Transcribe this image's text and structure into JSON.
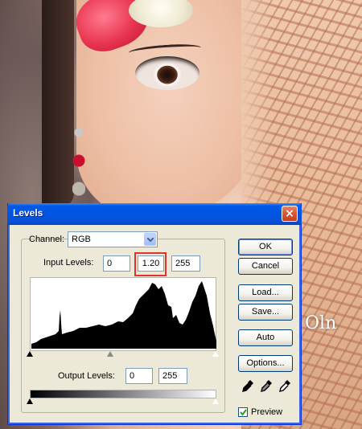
{
  "dialog": {
    "title": "Levels",
    "close_glyph": "×",
    "channel": {
      "label": "Channel:",
      "value": "RGB"
    },
    "input_levels": {
      "label": "Input Levels:",
      "black": "0",
      "gamma": "1.20",
      "white": "255"
    },
    "output_levels": {
      "label": "Output Levels:",
      "black": "0",
      "white": "255"
    },
    "buttons": {
      "ok": "OK",
      "cancel": "Cancel",
      "load": "Load...",
      "save": "Save...",
      "auto": "Auto",
      "options": "Options..."
    },
    "preview": {
      "label": "Preview",
      "checked": true
    },
    "eyedroppers": [
      "black-point-eyedropper",
      "gray-point-eyedropper",
      "white-point-eyedropper"
    ]
  },
  "background": {
    "watermark": "Oln"
  },
  "colors": {
    "title_bar": "#0054e3",
    "dialog_face": "#ece9d8",
    "highlight": "#e0332b"
  }
}
